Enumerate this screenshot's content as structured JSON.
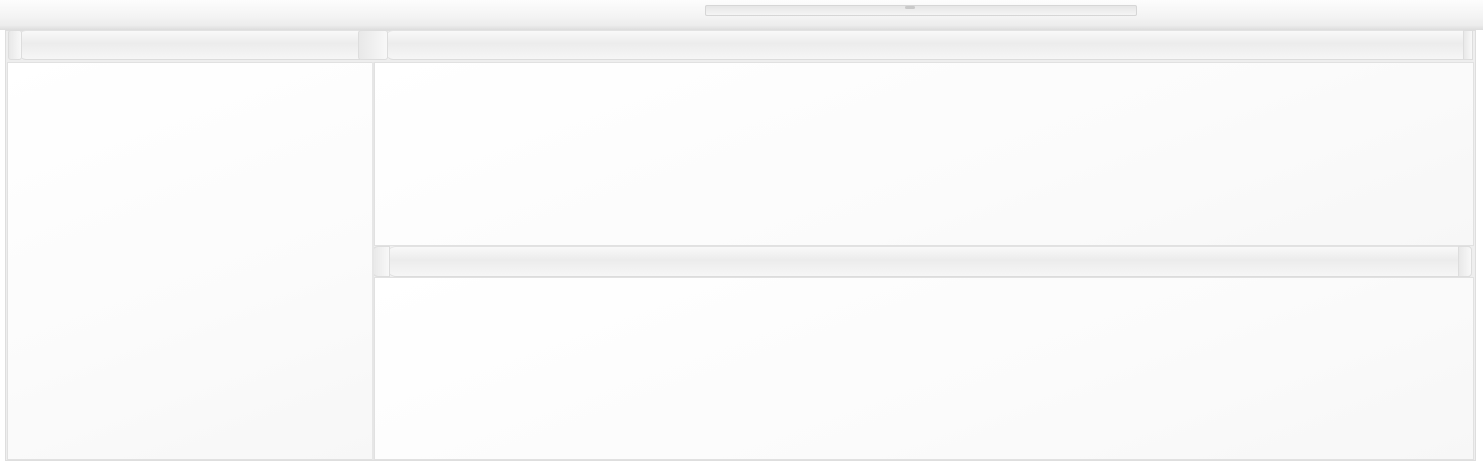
{
  "image": {
    "subject": "bathroom-vanity-cabinet",
    "colors": {
      "body": "#ffffff",
      "rail": "#eeeeee",
      "edge": "#dcdcdc"
    }
  },
  "parts": {
    "door_count": 1,
    "drawer_count": 2,
    "basin_count": 1
  }
}
